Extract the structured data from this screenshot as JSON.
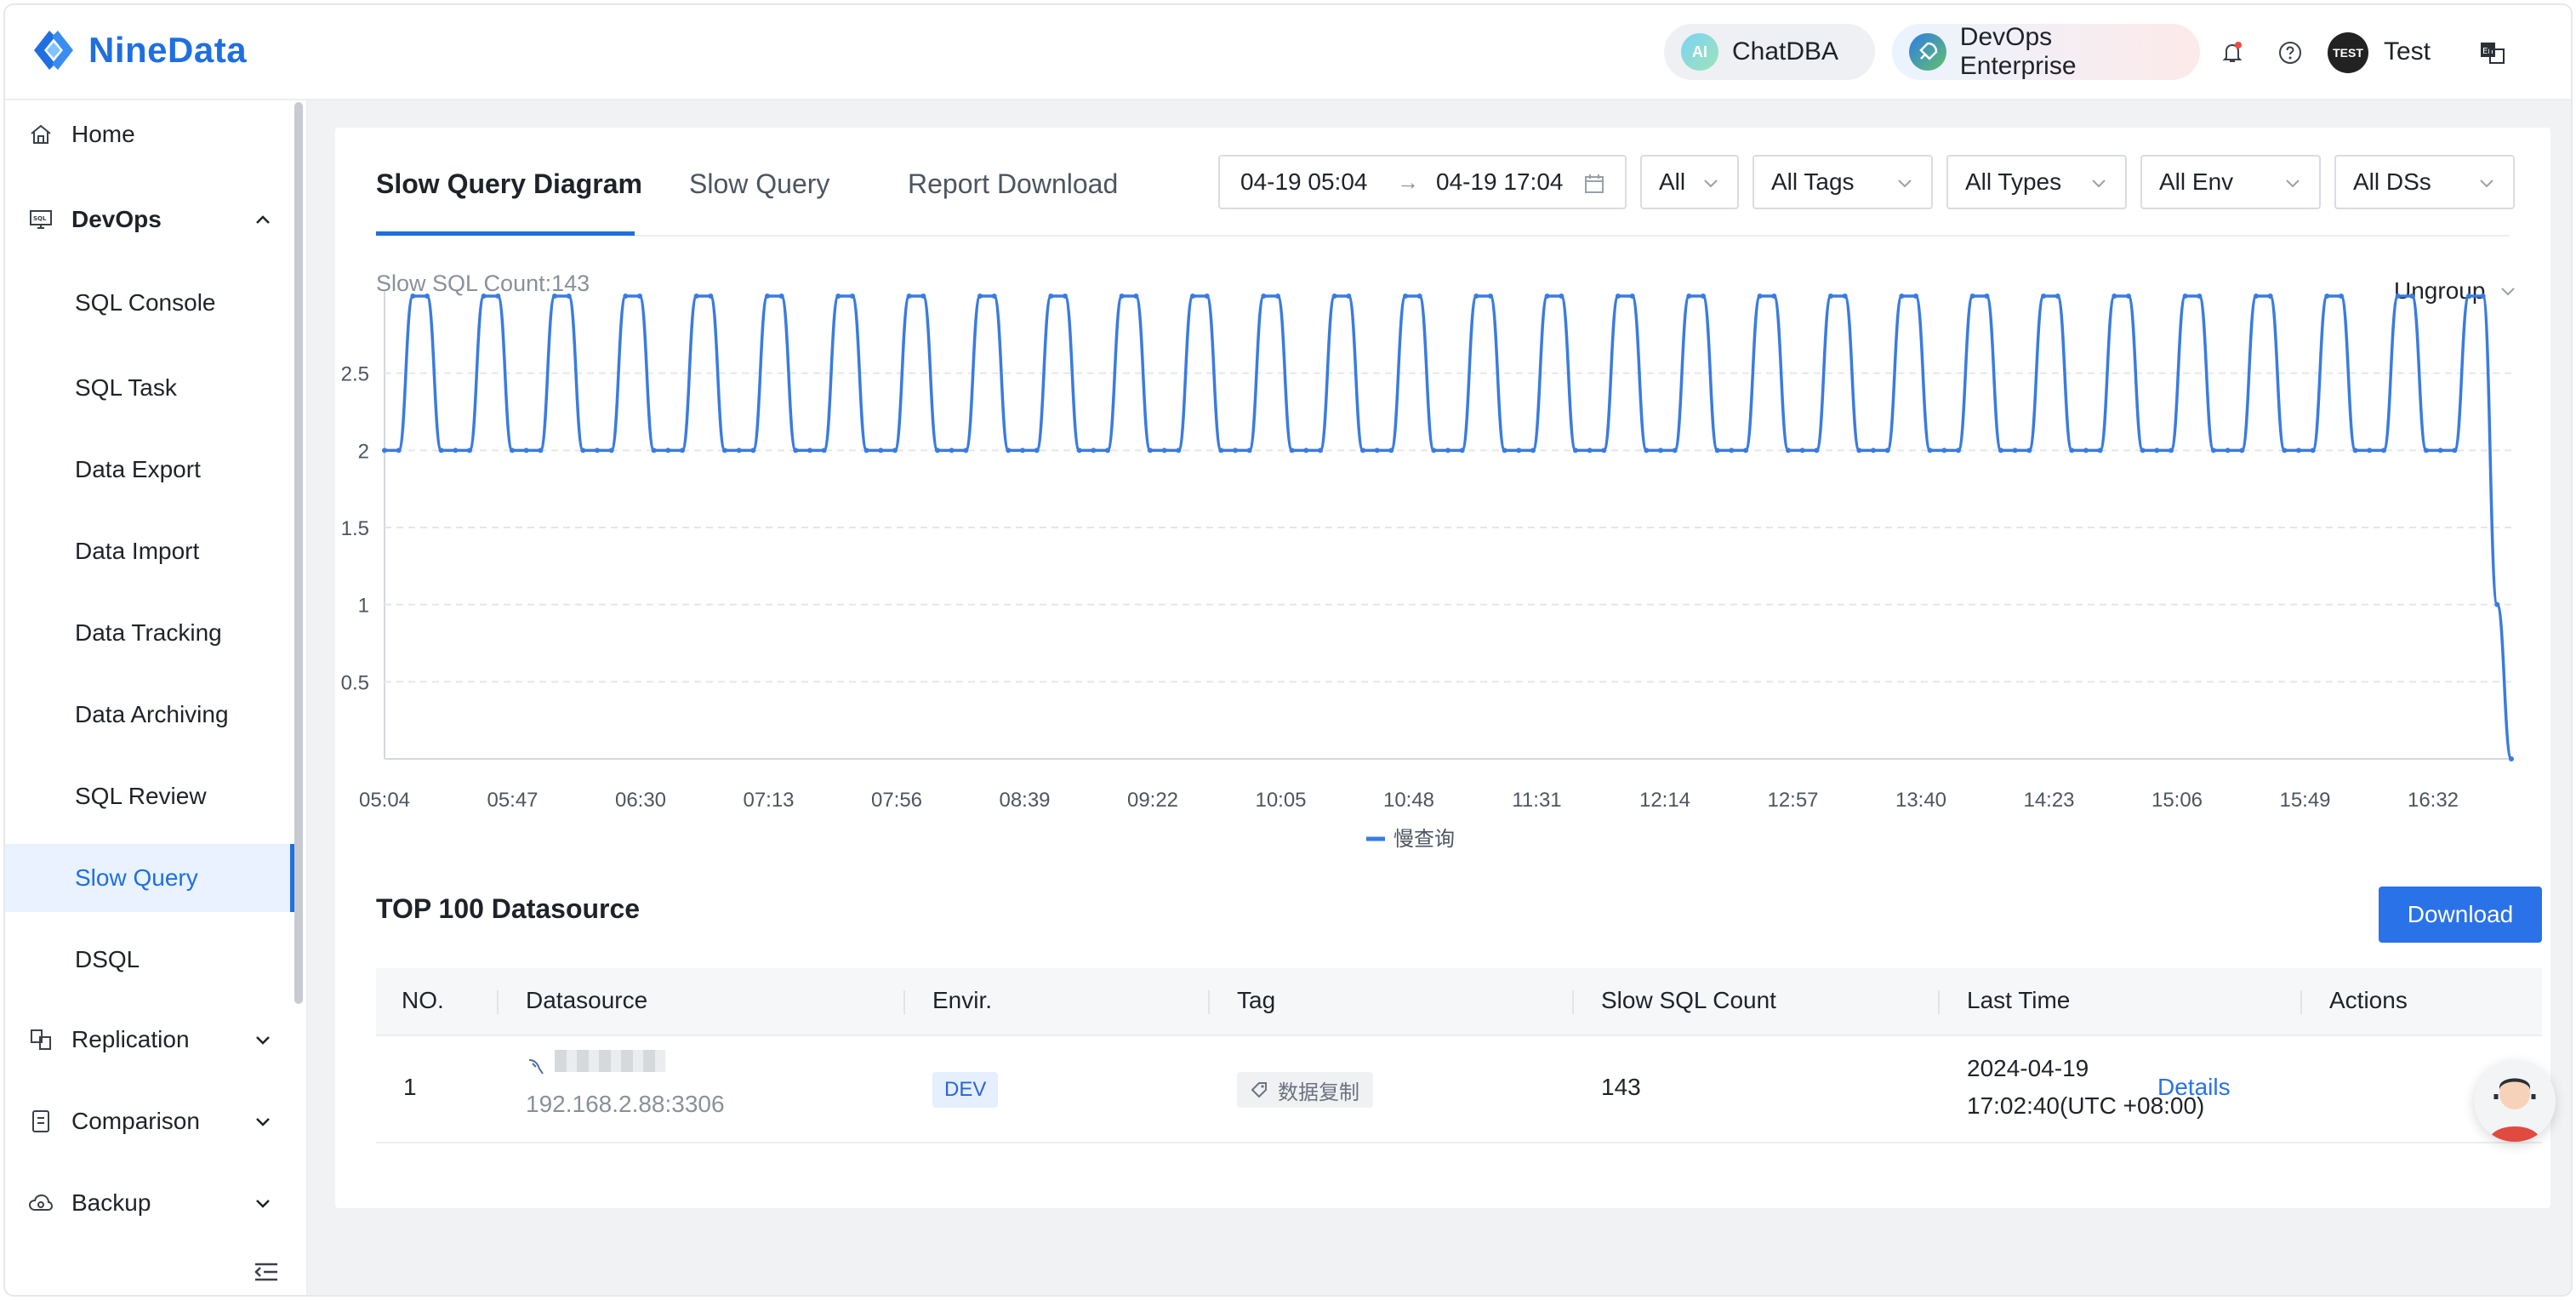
{
  "header": {
    "brand": "NineData",
    "chatdba_label": "ChatDBA",
    "ai_badge": "AI",
    "edition_label": "DevOps Enterprise",
    "avatar_text": "TEST",
    "username": "Test"
  },
  "sidebar": {
    "home": "Home",
    "devops": "DevOps",
    "devops_items": [
      "SQL Console",
      "SQL Task",
      "Data Export",
      "Data Import",
      "Data Tracking",
      "Data Archiving",
      "SQL Review",
      "Slow Query",
      "DSQL"
    ],
    "active_item": "Slow Query",
    "replication": "Replication",
    "comparison": "Comparison",
    "backup": "Backup"
  },
  "tabs": {
    "diagram": "Slow Query Diagram",
    "slow_query": "Slow Query",
    "report_download": "Report Download",
    "active": "Slow Query Diagram"
  },
  "filters": {
    "date_start": "04-19 05:04",
    "date_arrow": "→",
    "date_end": "04-19 17:04",
    "scope": "All",
    "tags": "All Tags",
    "types": "All Types",
    "env": "All Env",
    "datasources": "All DSs"
  },
  "summary": {
    "slow_sql_count_label": "Slow SQL Count:143",
    "group_mode": "Ungroup"
  },
  "chart_data": {
    "type": "line",
    "title": "",
    "xlabel": "",
    "ylabel": "",
    "x_tick_labels": [
      "05:04",
      "05:47",
      "06:30",
      "07:13",
      "07:56",
      "08:39",
      "09:22",
      "10:05",
      "10:48",
      "11:31",
      "12:14",
      "12:57",
      "13:40",
      "14:23",
      "15:06",
      "15:49",
      "16:32"
    ],
    "y_tick_labels": [
      "0.5",
      "1",
      "1.5",
      "2",
      "2.5"
    ],
    "ylim": [
      0,
      3
    ],
    "grid": true,
    "smooth": true,
    "legend_position": "bottom-center",
    "series": [
      {
        "name": "慢查询",
        "color": "#3a7be0",
        "values": [
          2,
          2,
          3,
          3,
          2,
          2,
          2,
          3,
          3,
          2,
          2,
          2,
          3,
          3,
          2,
          2,
          2,
          3,
          3,
          2,
          2,
          2,
          3,
          3,
          2,
          2,
          2,
          3,
          3,
          2,
          2,
          2,
          3,
          3,
          2,
          2,
          2,
          3,
          3,
          2,
          2,
          2,
          3,
          3,
          2,
          2,
          2,
          3,
          3,
          2,
          2,
          2,
          3,
          3,
          2,
          2,
          2,
          3,
          3,
          2,
          2,
          2,
          3,
          3,
          2,
          2,
          2,
          3,
          3,
          2,
          2,
          2,
          3,
          3,
          2,
          2,
          2,
          3,
          3,
          2,
          2,
          2,
          3,
          3,
          2,
          2,
          2,
          3,
          3,
          2,
          2,
          2,
          3,
          3,
          2,
          2,
          2,
          3,
          3,
          2,
          2,
          2,
          3,
          3,
          2,
          2,
          2,
          3,
          3,
          2,
          2,
          2,
          3,
          3,
          2,
          2,
          2,
          3,
          3,
          2,
          2,
          2,
          3,
          3,
          2,
          2,
          2,
          3,
          3,
          2,
          2,
          2,
          3,
          3,
          2,
          2,
          2,
          3,
          3,
          2,
          2,
          2,
          3,
          3,
          2,
          2,
          2,
          3,
          3,
          1,
          0
        ]
      }
    ]
  },
  "datasource_table": {
    "title": "TOP 100 Datasource",
    "download_label": "Download",
    "columns": [
      "NO.",
      "Datasource",
      "Envir.",
      "Tag",
      "Slow SQL Count",
      "Last Time",
      "Actions"
    ],
    "rows": [
      {
        "no": "1",
        "host": "192.168.2.88:3306",
        "env": "DEV",
        "tag": "数据复制",
        "count": "143",
        "last_time_date": "2024-04-19",
        "last_time_time": "17:02:40(UTC +08:00)",
        "action": "Details"
      }
    ]
  }
}
